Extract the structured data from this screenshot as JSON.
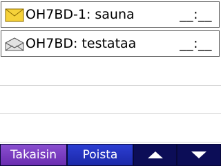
{
  "messages": [
    {
      "text": "OH7BD-1: sauna",
      "time": "__:__",
      "icon": "envelope-unread-icon",
      "icon_color": "#f6d23a"
    },
    {
      "text": "OH7BD: testataa",
      "time": "__:__",
      "icon": "envelope-read-icon",
      "icon_color": "#d8d8d8"
    }
  ],
  "toolbar": {
    "back_label": "Takaisin",
    "delete_label": "Poista",
    "up_icon": "triangle-up-icon",
    "down_icon": "triangle-down-icon"
  },
  "colors": {
    "back_button": "#7a3cc0",
    "delete_button": "#2535c0",
    "toolbar_bg": "#0c0d57"
  }
}
